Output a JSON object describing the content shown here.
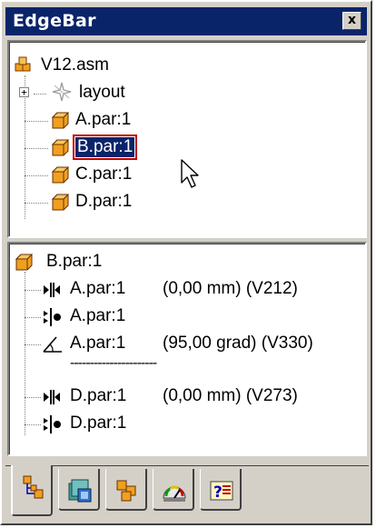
{
  "window": {
    "title": "EdgeBar",
    "close_label": "x"
  },
  "tree": {
    "root": "V12.asm",
    "items": [
      {
        "label": "layout",
        "icon": "sketch-icon",
        "expandable": true
      },
      {
        "label": "A.par:1",
        "icon": "part-cube-icon"
      },
      {
        "label": "B.par:1",
        "icon": "part-cube-icon",
        "selected": true
      },
      {
        "label": "C.par:1",
        "icon": "part-cube-icon"
      },
      {
        "label": "D.par:1",
        "icon": "part-cube-icon"
      }
    ]
  },
  "relationships": {
    "part": "B.par:1",
    "items": [
      {
        "icon": "mate-icon",
        "part": "A.par:1",
        "detail": "(0,00 mm) (V212)"
      },
      {
        "icon": "axial-align-icon",
        "part": "A.par:1",
        "detail": ""
      },
      {
        "icon": "angle-icon",
        "part": "A.par:1",
        "detail": "(95,00 grad) (V330)"
      },
      {
        "separator": "----------------------"
      },
      {
        "icon": "mate-icon",
        "part": "D.par:1",
        "detail": "(0,00 mm) (V273)"
      },
      {
        "icon": "axial-align-icon",
        "part": "D.par:1",
        "detail": ""
      }
    ]
  },
  "tabs": [
    {
      "name": "tab-feature-pathfinder",
      "icon": "pathfinder-icon",
      "active": true
    },
    {
      "name": "tab-library",
      "icon": "library-icon"
    },
    {
      "name": "tab-assembly-pathfinder",
      "icon": "assembly-icon"
    },
    {
      "name": "tab-measure",
      "icon": "gauge-icon"
    },
    {
      "name": "tab-help",
      "icon": "help-icon"
    }
  ],
  "colors": {
    "titlebar": "#0a246a",
    "selection": "#0a246a",
    "selection_outline": "#c00000",
    "cube": "#f0a020",
    "face": "#d4d0c8"
  }
}
